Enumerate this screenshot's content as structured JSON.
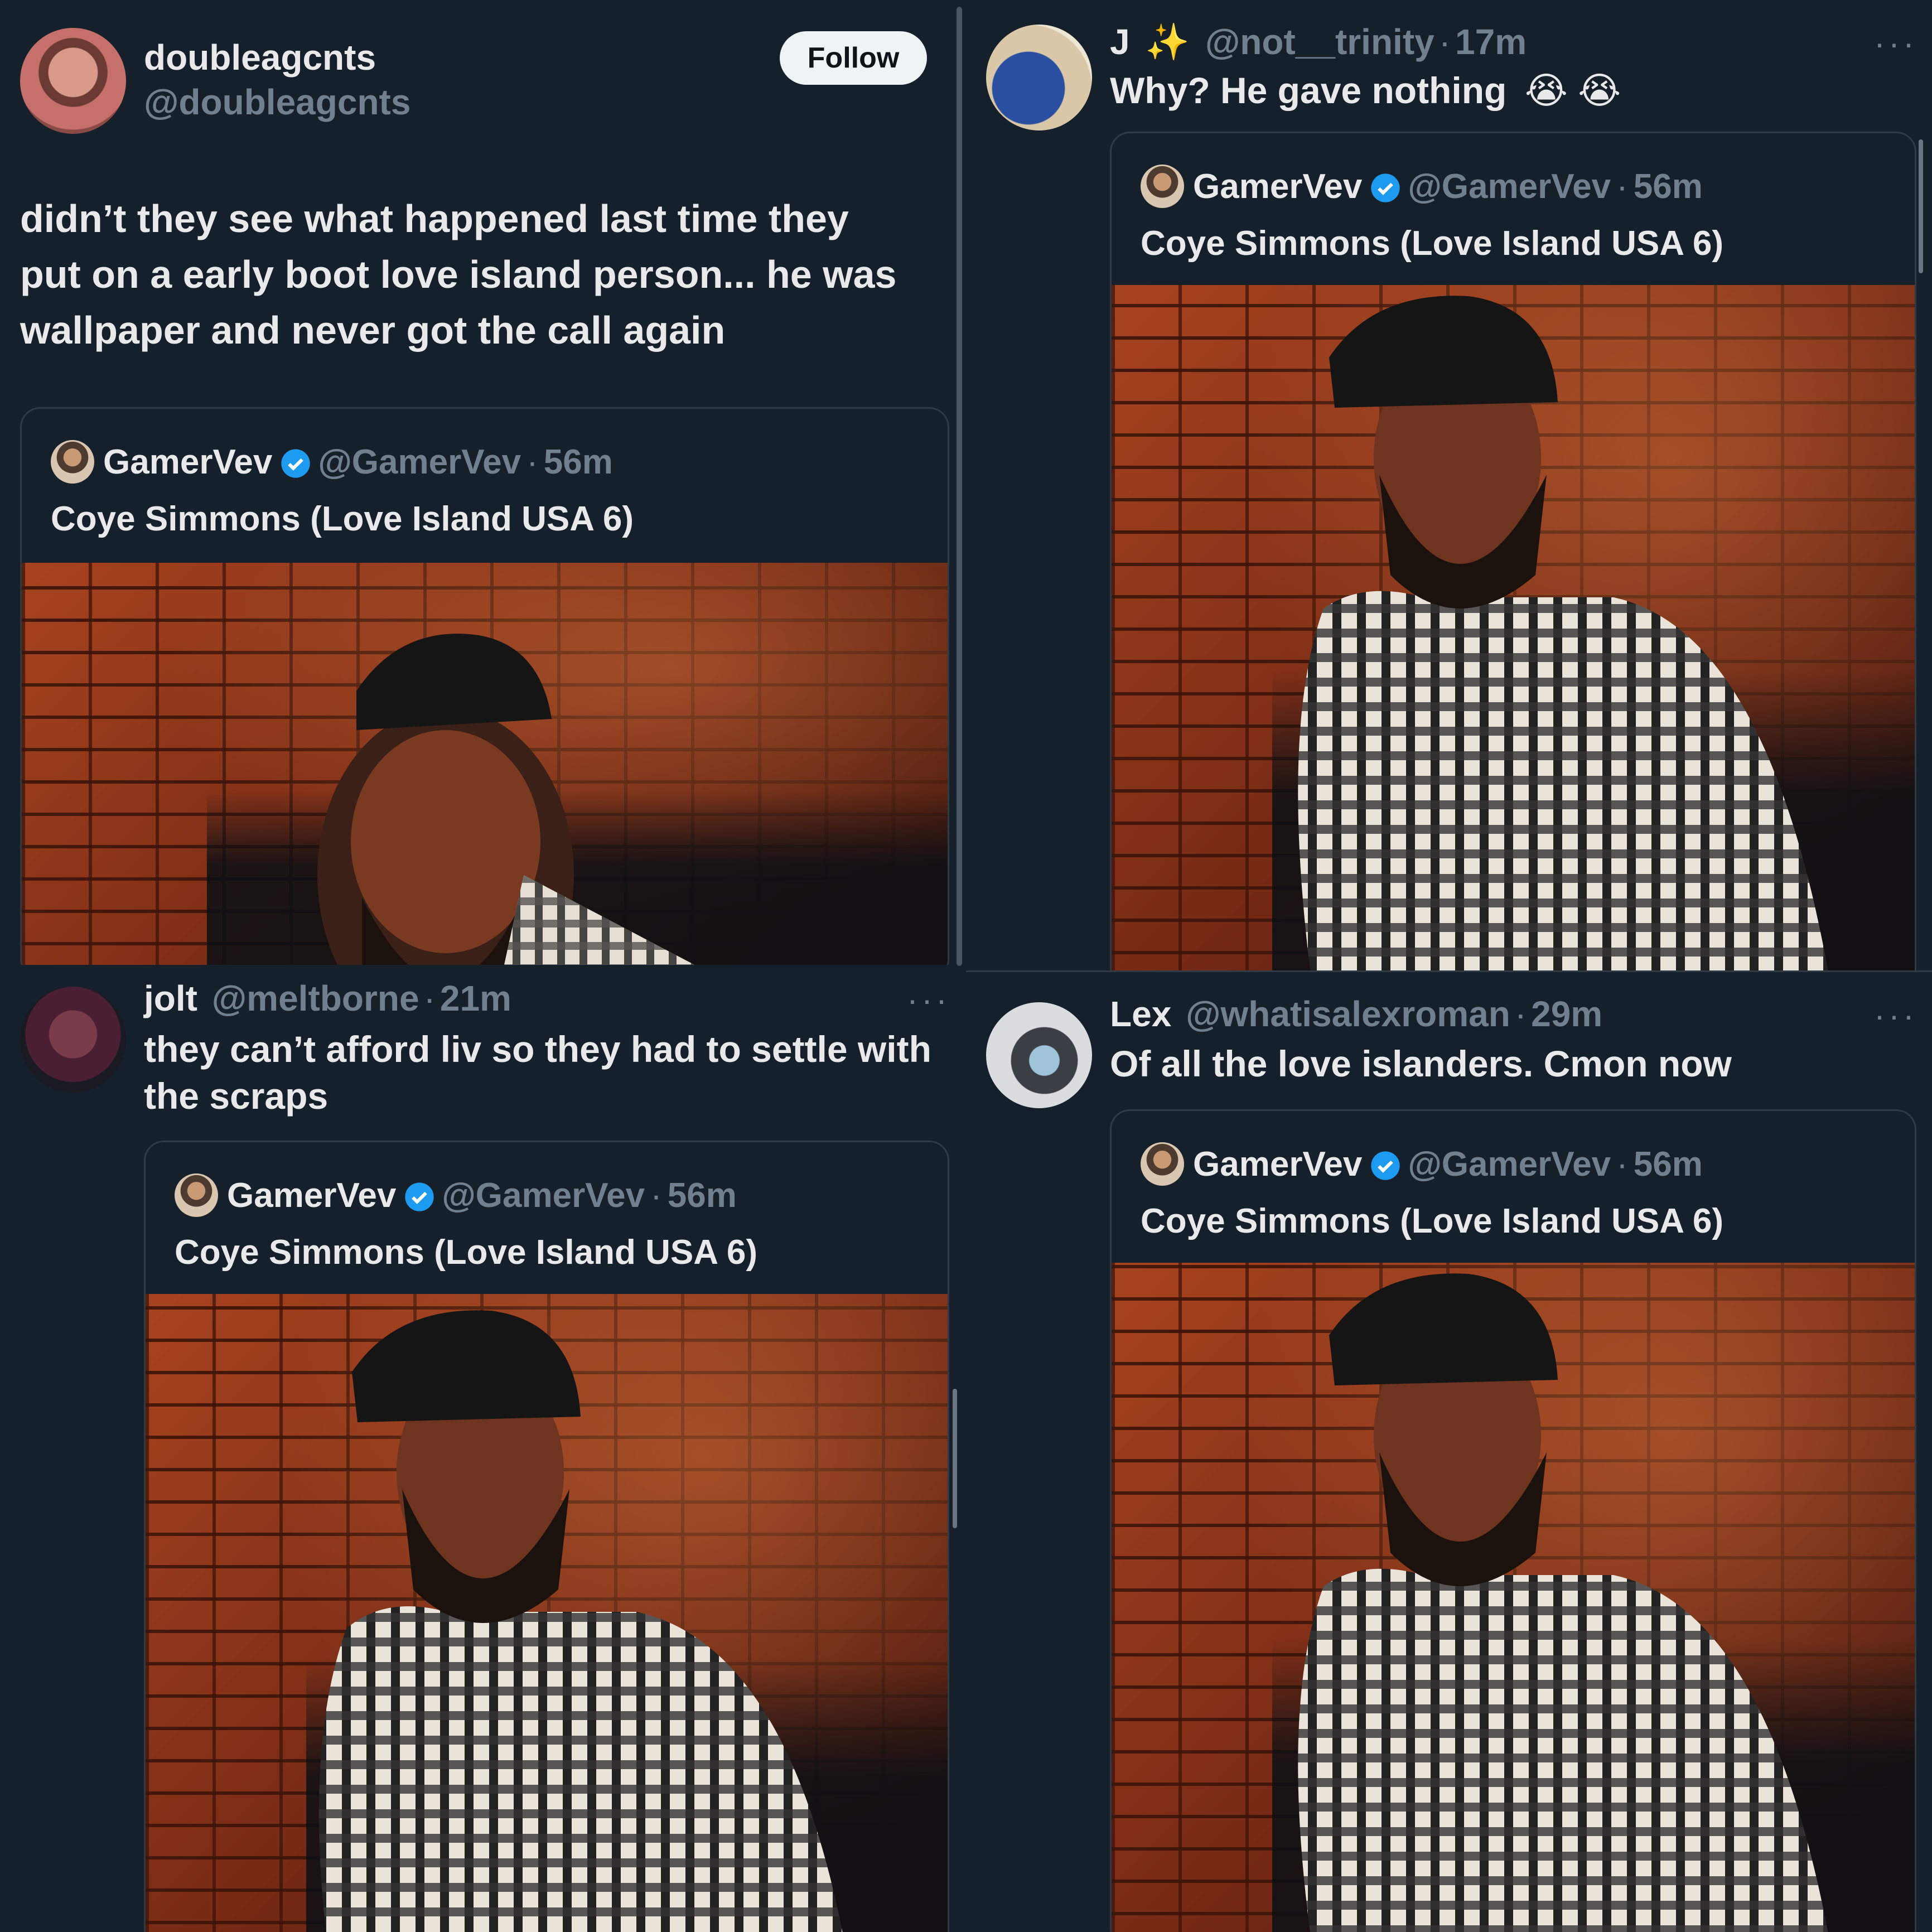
{
  "colors": {
    "background": "#16202b",
    "text": "#e7e9ea",
    "muted": "#71808f",
    "verified": "#1d9bf0",
    "border": "#2f3a45"
  },
  "quoted_tweet": {
    "name": "GamerVev",
    "handle": "@GamerVev",
    "time": "56m",
    "text": "Coye Simmons (Love Island USA 6)"
  },
  "posts": [
    {
      "id": "top-left",
      "name": "doubleagcnts",
      "handle": "@doubleagcnts",
      "follow_label": "Follow",
      "text_lines": [
        "didn’t they see what happened last time they",
        "put on a early boot love island person... he was",
        "wallpaper and never got the call again"
      ]
    },
    {
      "id": "top-right",
      "name": "J",
      "name_emoji": "✨",
      "handle": "@not__trinity",
      "time": "17m",
      "text": "Why? He gave nothing",
      "text_emoji": "😭 😭"
    },
    {
      "id": "bottom-left",
      "name": "jolt",
      "handle": "@meltborne",
      "time": "21m",
      "text_lines": [
        "they can’t afford liv so they had to settle with",
        "the scraps"
      ]
    },
    {
      "id": "bottom-right",
      "name": "Lex",
      "handle": "@whatisalexroman",
      "time": "29m",
      "text": "Of all the love islanders. Cmon now"
    }
  ],
  "separator": "·",
  "more_glyph": "···"
}
